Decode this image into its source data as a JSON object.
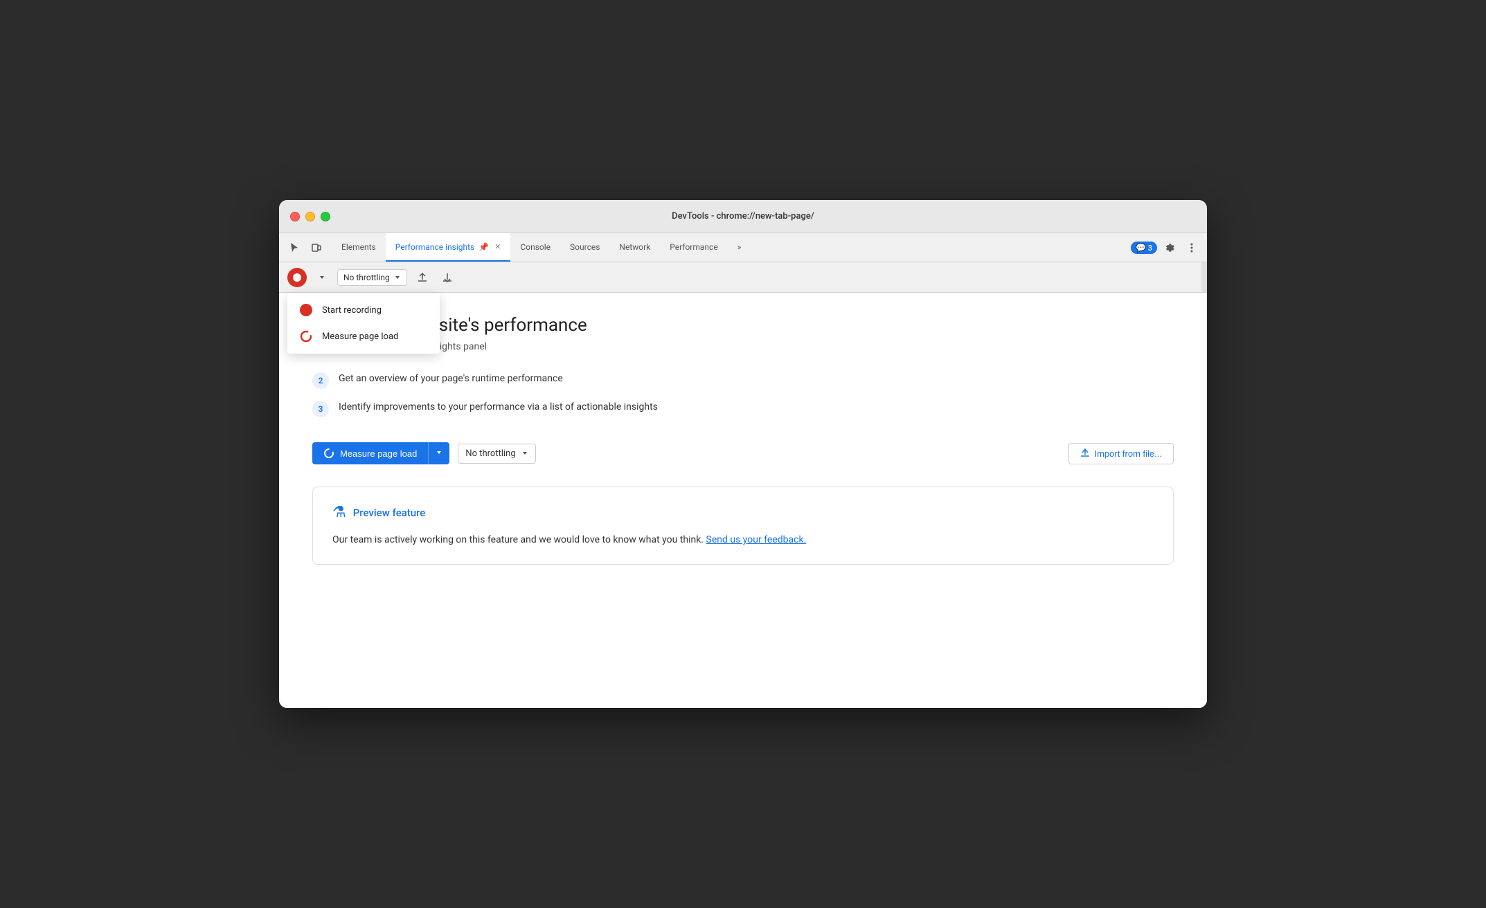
{
  "window": {
    "title": "DevTools - chrome://new-tab-page/"
  },
  "tabs": [
    {
      "id": "elements",
      "label": "Elements",
      "active": false
    },
    {
      "id": "performance-insights",
      "label": "Performance insights",
      "active": true,
      "closable": true
    },
    {
      "id": "console",
      "label": "Console",
      "active": false
    },
    {
      "id": "sources",
      "label": "Sources",
      "active": false
    },
    {
      "id": "network",
      "label": "Network",
      "active": false
    },
    {
      "id": "performance",
      "label": "Performance",
      "active": false
    }
  ],
  "toolbar": {
    "throttle_label": "No throttling",
    "record_label": "Record",
    "more_tools_label": "More"
  },
  "badge": {
    "count": "3"
  },
  "dropdown_menu": {
    "items": [
      {
        "id": "start-recording",
        "label": "Start recording",
        "icon": "record"
      },
      {
        "id": "measure-page-load",
        "label": "Measure page load",
        "icon": "refresh"
      }
    ]
  },
  "main": {
    "title": "hts on your website's performance",
    "subtitle": "race into the Performance Insights panel",
    "steps": [
      {
        "number": "2",
        "text": "Get an overview of your page's runtime performance"
      },
      {
        "number": "3",
        "text": "Identify improvements to your performance via a list of actionable insights"
      }
    ],
    "measure_btn": "Measure page load",
    "throttle_label": "No throttling",
    "import_btn": "Import from file...",
    "preview_section": {
      "title": "Preview feature",
      "text": "Our team is actively working on this feature and we would love to know what you think.",
      "link_text": "Send us your feedback."
    }
  }
}
